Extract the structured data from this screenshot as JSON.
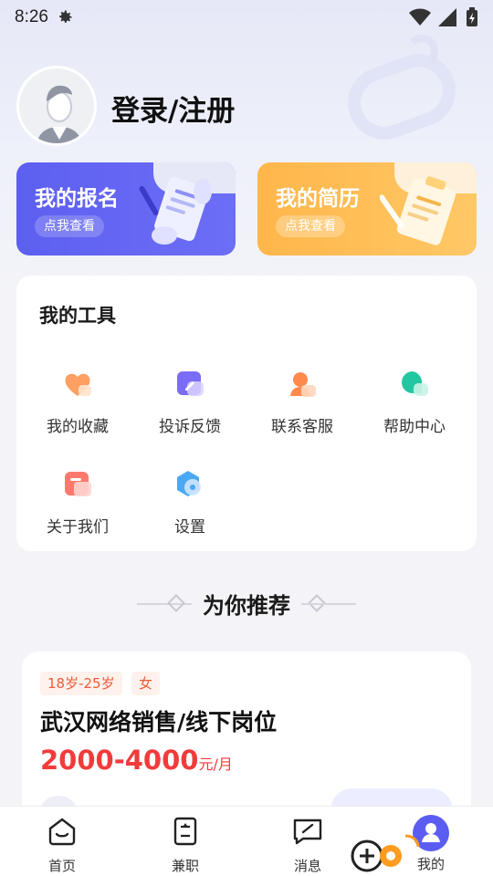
{
  "status_bar": {
    "time": "8:26"
  },
  "profile": {
    "login_label": "登录/注册"
  },
  "cards": {
    "signup": {
      "title": "我的报名",
      "button": "点我查看"
    },
    "resume": {
      "title": "我的简历",
      "button": "点我查看"
    }
  },
  "tools": {
    "title": "我的工具",
    "items": [
      {
        "label": "我的收藏",
        "icon": "heart-icon"
      },
      {
        "label": "投诉反馈",
        "icon": "feedback-icon"
      },
      {
        "label": "联系客服",
        "icon": "support-icon"
      },
      {
        "label": "帮助中心",
        "icon": "help-chat-icon"
      },
      {
        "label": "关于我们",
        "icon": "about-icon"
      },
      {
        "label": "设置",
        "icon": "settings-icon"
      }
    ]
  },
  "recommend": {
    "heading": "为你推荐",
    "job": {
      "tags": [
        "18岁-25岁",
        "女"
      ],
      "title": "武汉网络销售/线下岗位",
      "salary": "2000-4000",
      "salary_unit": "元/月"
    }
  },
  "nav": {
    "items": [
      {
        "label": "首页",
        "icon": "home-icon"
      },
      {
        "label": "兼职",
        "icon": "part-time-icon"
      },
      {
        "label": "消息",
        "icon": "message-icon"
      },
      {
        "label": "我的",
        "icon": "profile-icon"
      }
    ]
  },
  "colors": {
    "accent": "#5d5ff0",
    "resume_card": "#ffb64a",
    "salary": "#f23b3b",
    "tag_text": "#f25b37"
  }
}
